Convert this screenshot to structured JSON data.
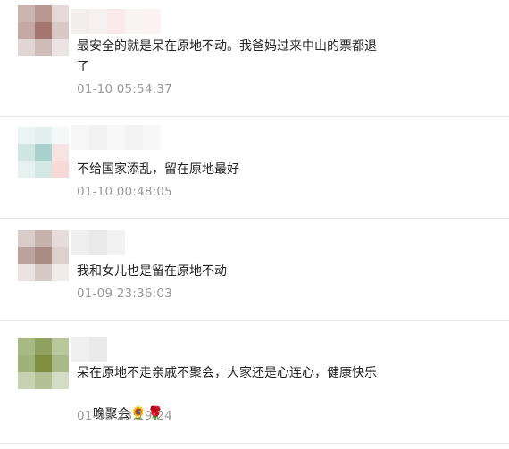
{
  "comments": [
    {
      "text_line1": "最安全的就是呆在原地不动。我爸妈过来中山的票都退",
      "text_line2": "了",
      "time": "01-10 05:54:37"
    },
    {
      "text_line1": "不给国家添乱，留在原地最好",
      "time": "01-10 00:48:05"
    },
    {
      "text_line1": "我和女儿也是留在原地不动",
      "time": "01-09 23:36:03"
    },
    {
      "text_line1": "呆在原地不走亲戚不聚会，大家还是心连心，健康快乐",
      "text_line2": "晚聚会",
      "emoji_1": "🌻",
      "emoji_2": "🌹",
      "time": "01-09 23:19:24"
    }
  ],
  "colors": {
    "text": "#222222",
    "timestamp": "#999999",
    "divider": "#e6e6e6"
  }
}
